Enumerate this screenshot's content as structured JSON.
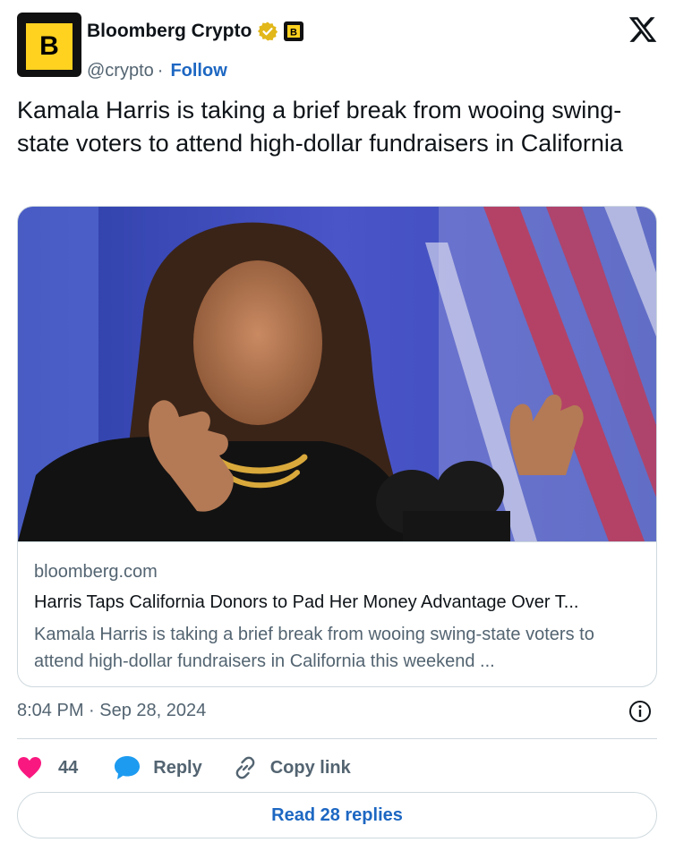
{
  "author": {
    "display_name": "Bloomberg Crypto",
    "handle": "@crypto",
    "separator": "·",
    "follow_label": "Follow",
    "avatar_letter": "B",
    "affiliate_letter": "B",
    "brand_color": "#ffd21f",
    "verified_color": "#e2b719"
  },
  "tweet": {
    "text": "Kamala Harris is taking a brief break from wooing swing-state voters to attend high-dollar fundraisers in California"
  },
  "card": {
    "domain": "bloomberg.com",
    "title": "Harris Taps California Donors to Pad Her Money Advantage Over T...",
    "description": "Kamala Harris is taking a brief break from wooing swing-state voters to attend high-dollar fundraisers in California this weekend ..."
  },
  "meta": {
    "timestamp": "8:04 PM · Sep 28, 2024"
  },
  "actions": {
    "like_count": "44",
    "reply_label": "Reply",
    "copy_label": "Copy link",
    "read_replies_label": "Read 28 replies"
  },
  "colors": {
    "link": "#1d67c2",
    "like": "#f91880",
    "reply_icon": "#1d9bf0",
    "muted": "#536471"
  },
  "icons": [
    "verified-icon",
    "affiliate-badge-icon",
    "x-logo-icon",
    "info-icon",
    "heart-icon",
    "reply-bubble-icon",
    "link-icon"
  ]
}
